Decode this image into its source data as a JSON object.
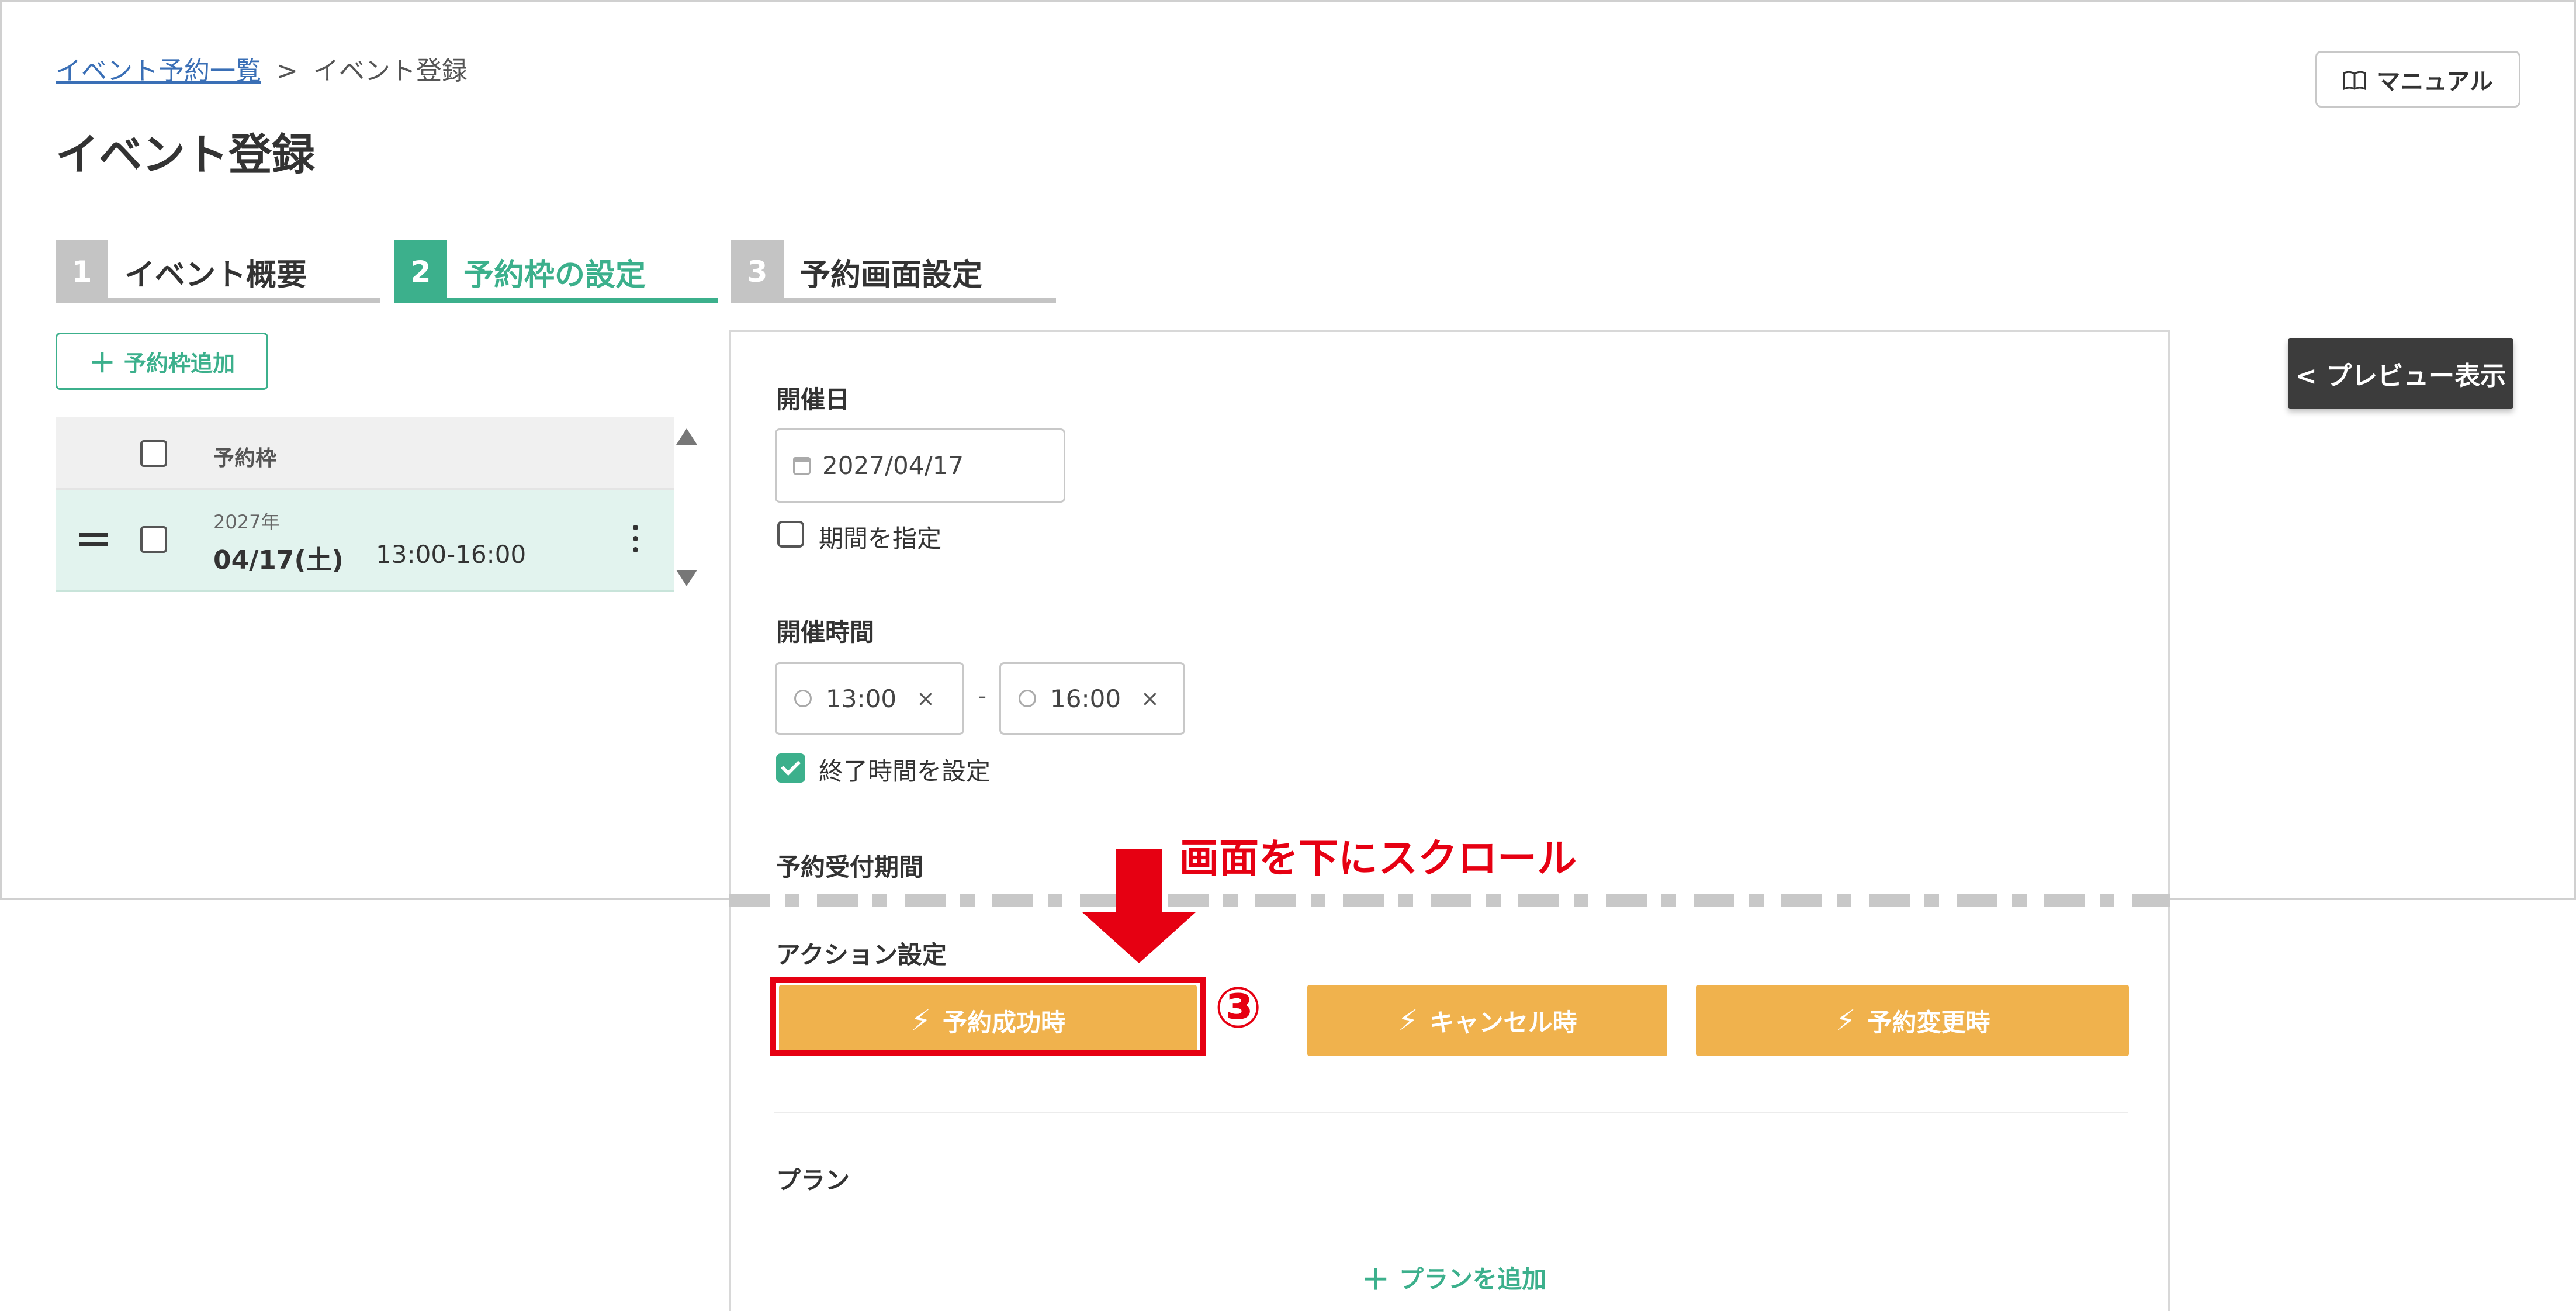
{
  "breadcrumb": {
    "parent": "イベント予約一覧",
    "separator": ">",
    "current": "イベント登録"
  },
  "page_title": "イベント登録",
  "manual_button": "マニュアル",
  "steps": [
    {
      "number": "1",
      "label": "イベント概要",
      "state": "done"
    },
    {
      "number": "2",
      "label": "予約枠の設定",
      "state": "active"
    },
    {
      "number": "3",
      "label": "予約画面設定",
      "state": "pending"
    }
  ],
  "add_slot_button": "予約枠追加",
  "slot_table": {
    "header": "予約枠",
    "rows": [
      {
        "year": "2027年",
        "date": "04/17(土)",
        "time": "13:00-16:00"
      }
    ]
  },
  "preview_button": "< プレビュー表示",
  "form": {
    "date_label": "開催日",
    "date_value": "2027/04/17",
    "range_checkbox": "期間を指定",
    "time_label": "開催時間",
    "start_time": "13:00",
    "end_time": "16:00",
    "time_separator": "-",
    "end_time_checkbox": "終了時間を設定",
    "reception_label": "予約受付期間",
    "action_label": "アクション設定",
    "actions": [
      "予約成功時",
      "キャンセル時",
      "予約変更時"
    ],
    "plan_label": "プラン",
    "add_plan": "プランを追加"
  },
  "annotation": {
    "scroll_text": "画面を下にスクロール",
    "step_number": "③"
  },
  "colors": {
    "accent": "#3cb08c",
    "action": "#f0b24d",
    "annotation": "#e60012",
    "link": "#3a6fb6"
  }
}
